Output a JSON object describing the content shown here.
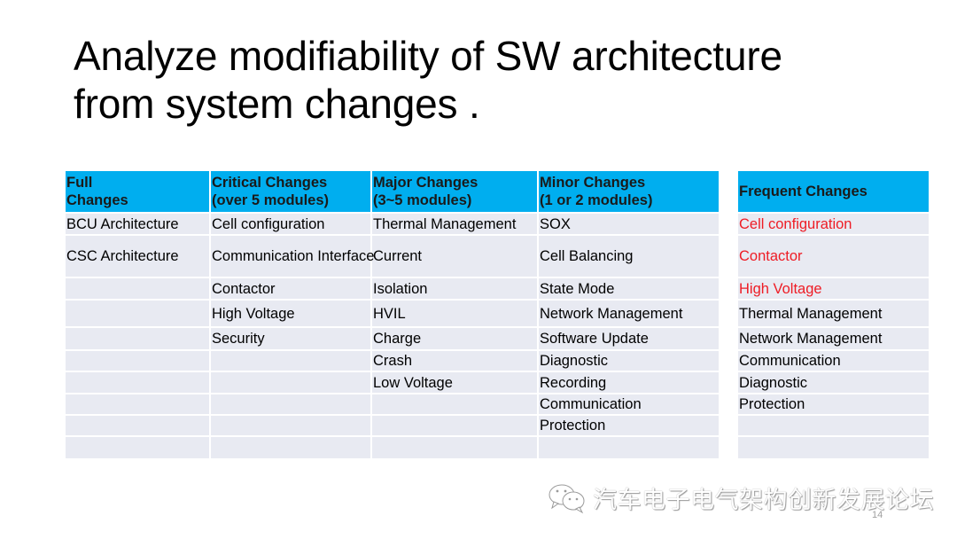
{
  "slide": {
    "title_lines": [
      "Analyze modifiability of SW architecture",
      "from system changes ."
    ],
    "page_number": "14"
  },
  "main_table": {
    "headers": [
      {
        "line1": "Full",
        "line2": "Changes"
      },
      {
        "line1": "Critical Changes",
        "line2": "(over 5 modules)"
      },
      {
        "line1": "Major Changes",
        "line2": "(3~5 modules)"
      },
      {
        "line1": "Minor Changes",
        "line2": "(1 or 2 modules)"
      }
    ],
    "rows": [
      [
        "BCU Architecture",
        "Cell configuration",
        "Thermal Management",
        "SOX"
      ],
      [
        "CSC Architecture",
        "Communication Interface",
        "Current",
        "Cell Balancing"
      ],
      [
        "",
        "Contactor",
        "Isolation",
        "State Mode"
      ],
      [
        "",
        "High Voltage",
        "HVIL",
        "Network Management"
      ],
      [
        "",
        "Security",
        "Charge",
        "Software Update"
      ],
      [
        "",
        "",
        "Crash",
        "Diagnostic"
      ],
      [
        "",
        "",
        "Low Voltage",
        "Recording"
      ],
      [
        "",
        "",
        "",
        "Communication"
      ],
      [
        "",
        "",
        "",
        "Protection"
      ],
      [
        "",
        "",
        "",
        ""
      ]
    ]
  },
  "frequent_table": {
    "header": "Frequent Changes",
    "highlight_color": "#ee1c25",
    "rows": [
      {
        "text": "Cell configuration",
        "highlight": true
      },
      {
        "text": "Contactor",
        "highlight": true
      },
      {
        "text": "High Voltage",
        "highlight": true
      },
      {
        "text": "Thermal Management",
        "highlight": false
      },
      {
        "text": "Network Management",
        "highlight": false
      },
      {
        "text": "Communication",
        "highlight": false
      },
      {
        "text": "Diagnostic",
        "highlight": false
      },
      {
        "text": "Protection",
        "highlight": false
      },
      {
        "text": "",
        "highlight": false
      },
      {
        "text": "",
        "highlight": false
      }
    ]
  },
  "colors": {
    "header_bg": "#00aeef",
    "cell_bg": "#e8eaf2",
    "highlight": "#ee1c25"
  },
  "watermark": {
    "icon": "wechat-icon",
    "text": "汽车电子电气架构创新发展论坛"
  }
}
